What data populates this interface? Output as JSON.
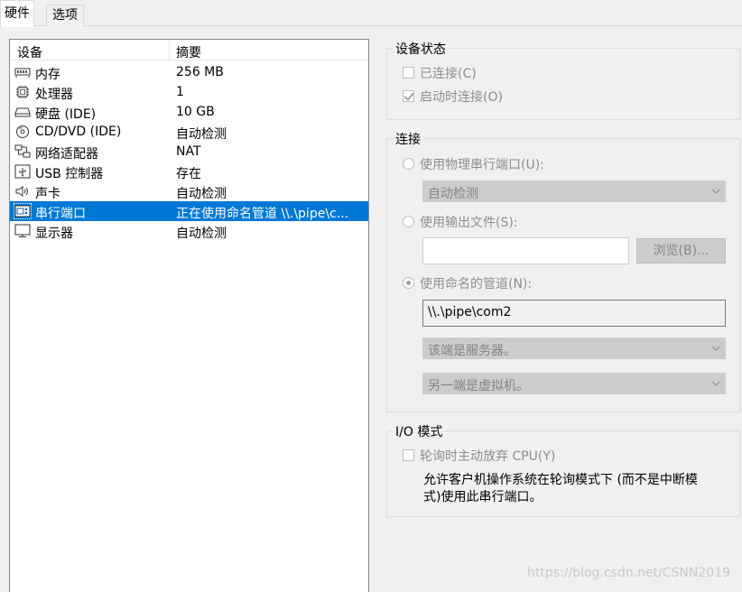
{
  "tabs": [
    {
      "label": "硬件",
      "active": true
    },
    {
      "label": "选项",
      "active": false
    }
  ],
  "device_list": {
    "header": {
      "device": "设备",
      "summary": "摘要"
    },
    "rows": [
      {
        "icon": "memory-icon",
        "name": "内存",
        "summary": "256 MB"
      },
      {
        "icon": "processor-icon",
        "name": "处理器",
        "summary": "1"
      },
      {
        "icon": "hard-disk-icon",
        "name": "硬盘 (IDE)",
        "summary": "10 GB"
      },
      {
        "icon": "cd-dvd-icon",
        "name": "CD/DVD (IDE)",
        "summary": "自动检测"
      },
      {
        "icon": "network-adapter-icon",
        "name": "网络适配器",
        "summary": "NAT"
      },
      {
        "icon": "usb-icon",
        "name": "USB 控制器",
        "summary": "存在"
      },
      {
        "icon": "sound-card-icon",
        "name": "声卡",
        "summary": "自动检测"
      },
      {
        "icon": "serial-port-icon",
        "name": "串行端口",
        "summary": "正在使用命名管道 \\\\.\\pipe\\c...",
        "selected": true
      },
      {
        "icon": "display-icon",
        "name": "显示器",
        "summary": "自动检测"
      }
    ]
  },
  "device_status": {
    "title": "设备状态",
    "connected": {
      "label": "已连接(C)",
      "checked": false
    },
    "connect_at_power_on": {
      "label": "启动时连接(O)",
      "checked": true
    }
  },
  "connection": {
    "title": "连接",
    "physical": {
      "label": "使用物理串行端口(U):",
      "combo": "自动检测"
    },
    "output_file": {
      "label": "使用输出文件(S):",
      "value": "",
      "browse": "浏览(B)..."
    },
    "named_pipe": {
      "label": "使用命名的管道(N):",
      "value": "\\\\.\\pipe\\com2",
      "end_combo": "该端是服务器。",
      "other_combo": "另一端是虚拟机。"
    }
  },
  "io_mode": {
    "title": "I/O 模式",
    "yield_cpu": {
      "label": "轮询时主动放弃 CPU(Y)",
      "checked": false
    },
    "description_line1": "允许客户机操作系统在轮询模式下 (而不是中断模",
    "description_line2": "式)使用此串行端口。"
  },
  "watermark": "https://blog.csdn.net/CSNN2019",
  "colors": {
    "selection": "#0078d7",
    "disabled_text": "#8d8d8d"
  }
}
